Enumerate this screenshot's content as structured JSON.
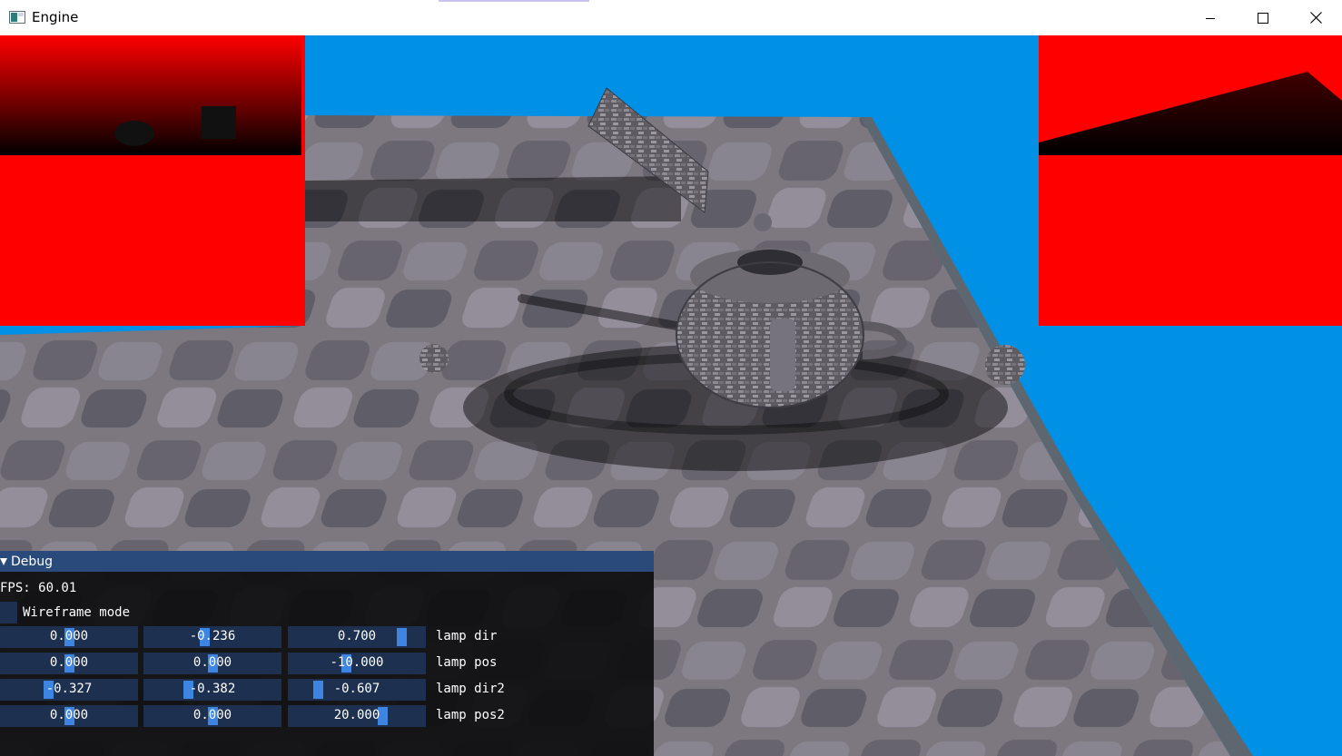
{
  "window": {
    "title": "Engine",
    "minimize_icon": "minimize-icon",
    "maximize_icon": "maximize-icon",
    "close_icon": "close-icon"
  },
  "scene": {
    "sky_color": "#0090e6",
    "shadow_map_color": "#ff0000",
    "objects": [
      "stone-floor",
      "teapot",
      "tilted-slab",
      "left-lamp-sphere",
      "right-lamp-sphere"
    ]
  },
  "debug": {
    "title": "Debug",
    "fps": "FPS: 60.01",
    "wireframe_label": "Wireframe mode",
    "rows": [
      {
        "label": "lamp dir",
        "values": [
          "0.000",
          "-0.236",
          "0.700"
        ],
        "slider_fraction": [
          0.5,
          0.44,
          0.85
        ]
      },
      {
        "label": "lamp pos",
        "values": [
          "0.000",
          "0.000",
          "-10.000"
        ],
        "slider_fraction": [
          0.5,
          0.5,
          0.42
        ]
      },
      {
        "label": "lamp dir2",
        "values": [
          "-0.327",
          "-0.382",
          "-0.607"
        ],
        "slider_fraction": [
          0.34,
          0.31,
          0.2
        ]
      },
      {
        "label": "lamp pos2",
        "values": [
          "0.000",
          "0.000",
          "20.000"
        ],
        "slider_fraction": [
          0.5,
          0.5,
          0.7
        ]
      }
    ],
    "colors": {
      "header": "#294a7a",
      "field": "#1d3050",
      "grab": "#3d85e0"
    }
  }
}
